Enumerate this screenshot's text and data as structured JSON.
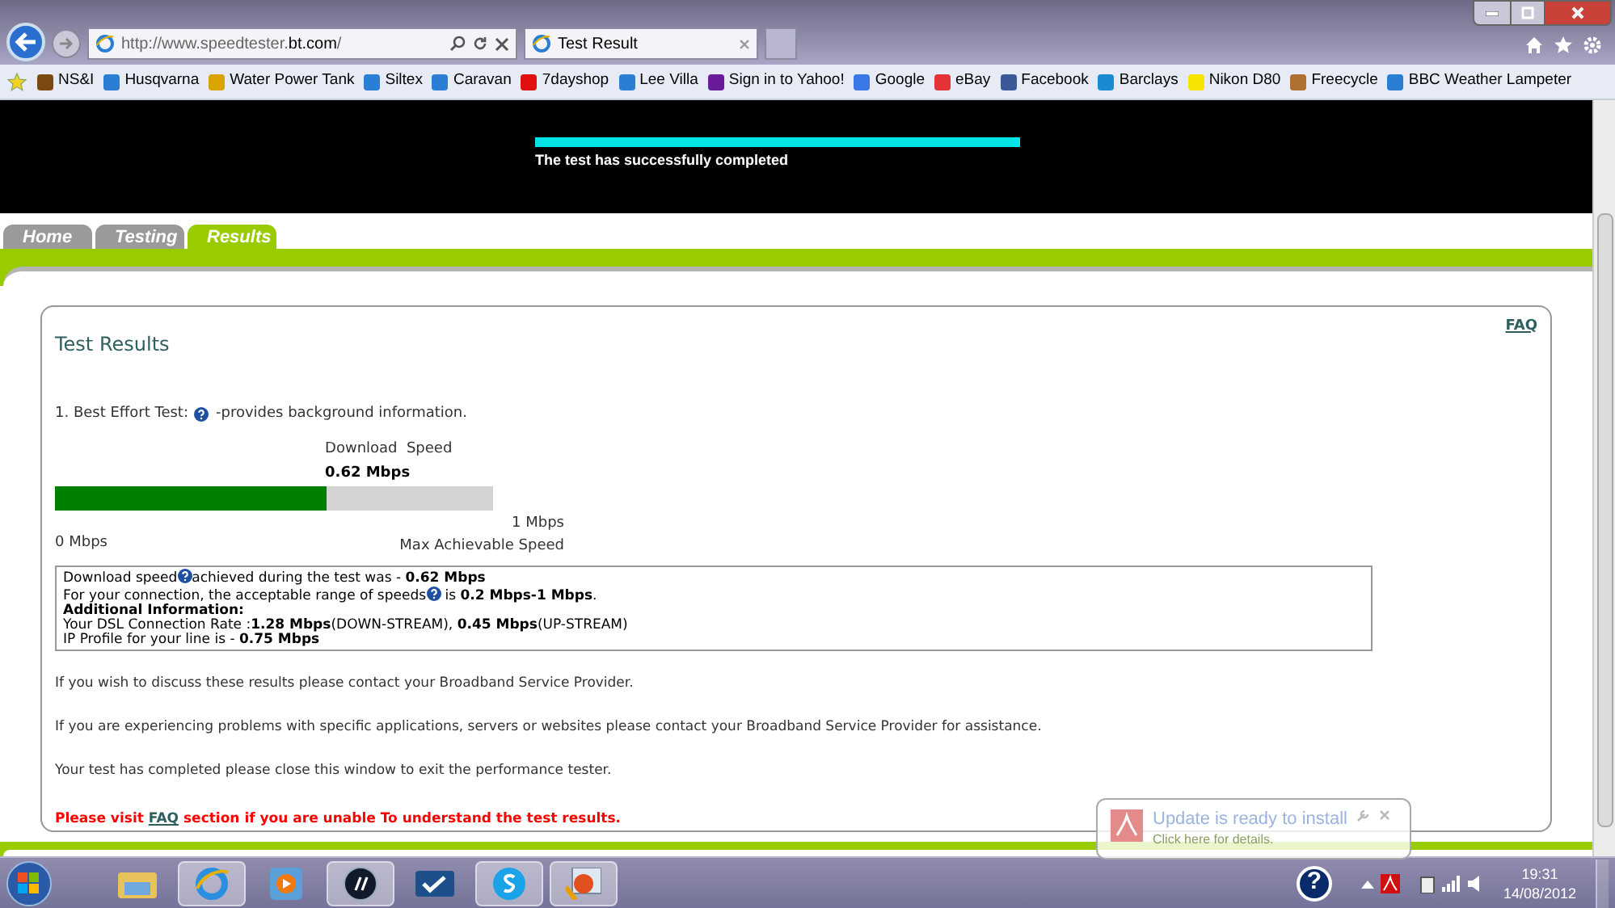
{
  "browser": {
    "address_prefix": "http://www.speedtester.",
    "address_domain": "bt.com",
    "address_suffix": "/",
    "tab_title": "Test Result"
  },
  "bookmarks": [
    "NS&I",
    "Husqvarna",
    "Water Power Tank",
    "Siltex",
    "Caravan",
    "7dayshop",
    "Lee Villa",
    "Sign in to Yahoo!",
    "Google",
    "eBay",
    "Facebook",
    "Barclays",
    "Nikon D80",
    "Freecycle",
    "BBC Weather  Lampeter"
  ],
  "header": {
    "status": "The test has successfully completed",
    "level": 1
  },
  "nav_tabs": [
    {
      "label": "Home",
      "selected": false
    },
    {
      "label": "Testing",
      "selected": false
    },
    {
      "label": "Results",
      "selected": true
    }
  ],
  "card": {
    "title": "Test Results",
    "faq_link": "FAQ",
    "test_line_prefix": "1. Best Effort Test:",
    "test_line_suffix": "-provides background information.",
    "meter": {
      "label": "Download  Speed",
      "value": "0.62 Mbps",
      "level": 0.62,
      "min": "0 Mbps",
      "max": "1 Mbps",
      "max_caption": "Max Achievable Speed"
    },
    "info_lines": [
      {
        "before": "Download speed",
        "help": true,
        "after": "achieved during the test was - **0.62 Mbps**"
      },
      {
        "before": "For your connection, the acceptable range of speeds",
        "help": true,
        "after": " is **0.2 Mbps-1 Mbps**."
      },
      {
        "before": "**Additional Information:**",
        "help": false
      },
      {
        "before": "Your DSL Connection Rate :**1.28 Mbps**(DOWN-STREAM), **0.45 Mbps**(UP-STREAM)",
        "help": false
      },
      {
        "before": "IP Profile for your line is - **0.75 Mbps**",
        "help": false
      }
    ],
    "paragraphs": [
      "If you wish to discuss these results please contact your Broadband Service Provider.",
      "If you are experiencing problems with specific applications, servers or websites please contact your Broadband Service Provider for assistance.",
      "Your test has completed please close this window to exit the performance tester."
    ],
    "notice": {
      "before": "Please visit",
      "link": "FAQ",
      "after": "section if you are unable To understand the test results."
    }
  },
  "notification": {
    "title": "Update is ready to install",
    "subtitle": "Click here for details."
  },
  "tray": {
    "help_badge": "?",
    "time": "19:31",
    "date": "14/08/2012"
  }
}
